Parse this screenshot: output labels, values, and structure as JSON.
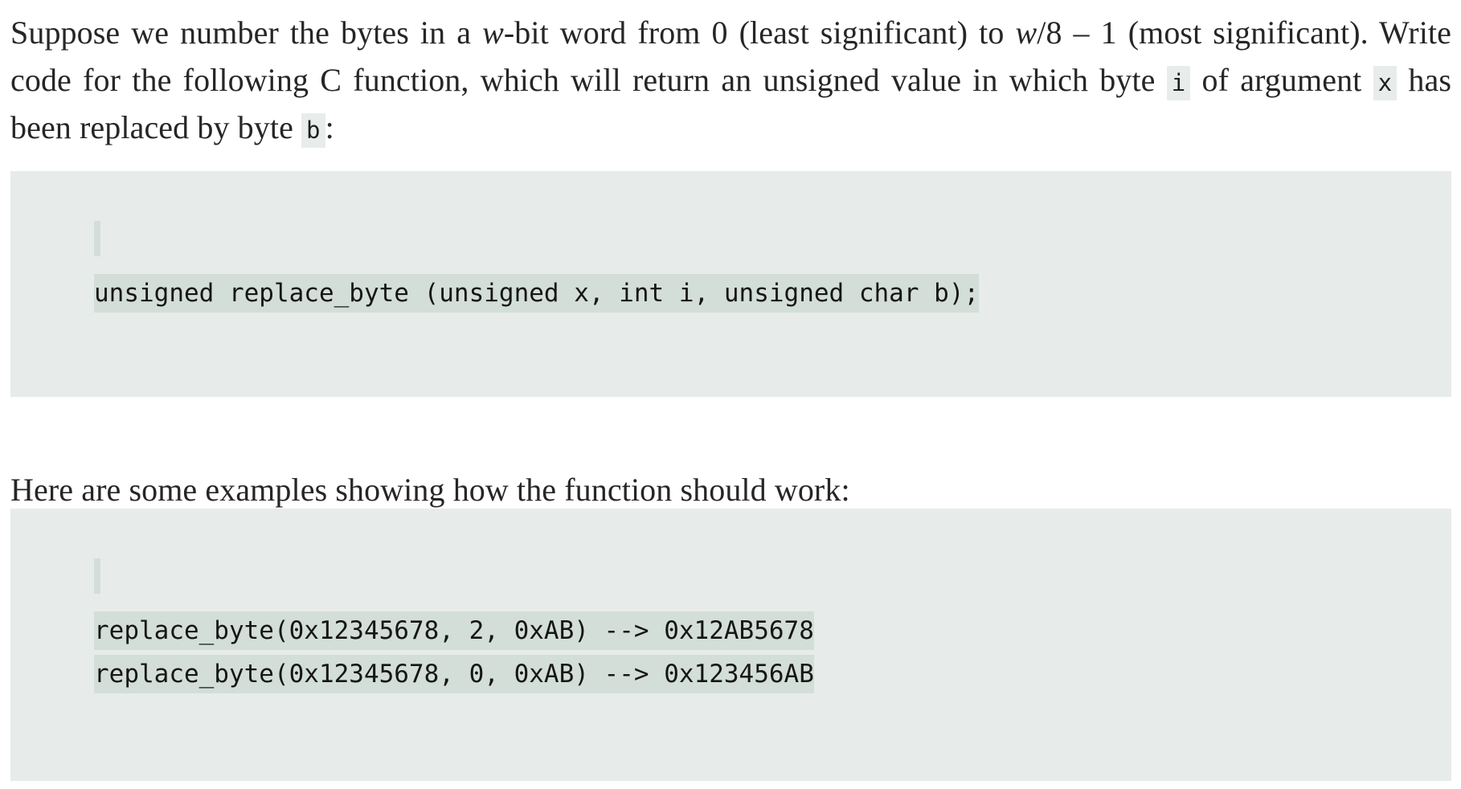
{
  "document": {
    "background_color": "#ffffff",
    "text_color": "#262626",
    "code_block_bg": "#e7ecea",
    "code_line_highlight_bg": "#d3ded8",
    "inline_code_bg": "#e8ecea"
  },
  "paragraphs": {
    "intro": {
      "seg1": "Suppose we number the bytes in a ",
      "em1": "w",
      "seg2": "-bit word from 0 (least significant) to ",
      "em2": "w",
      "seg3": "/8 – 1 (most significant). Write code for the following C function, which will return an unsigned value in which byte ",
      "code_i": "i",
      "seg4": " of argument ",
      "code_x": "x",
      "seg5": " has been replaced by byte ",
      "code_b": "b",
      "seg6": ":"
    },
    "examples_lead": "Here are some examples showing how the function should work:"
  },
  "code_blocks": [
    {
      "name": "function-signature",
      "caret_line": "",
      "lines": [
        "unsigned replace_byte (unsigned x, int i, unsigned char b);"
      ]
    },
    {
      "name": "usage-examples",
      "caret_line": "",
      "lines": [
        "replace_byte(0x12345678, 2, 0xAB) --> 0x12AB5678",
        "replace_byte(0x12345678, 0, 0xAB) --> 0x123456AB"
      ]
    }
  ]
}
